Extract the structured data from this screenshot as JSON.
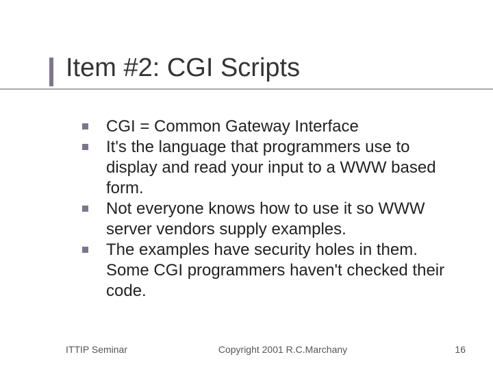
{
  "title": "Item #2:  CGI Scripts",
  "bullets": [
    "CGI = Common Gateway Interface",
    "It's the language that programmers use to display and read your input to a WWW based form.",
    "Not everyone knows how to use it so WWW server vendors supply examples.",
    "The examples have security holes in them. Some CGI programmers haven't checked their code."
  ],
  "footer": {
    "left": "ITTIP Seminar",
    "center": "Copyright 2001 R.C.Marchany",
    "right": "16"
  },
  "colors": {
    "accent": "#7e758d",
    "underline": "#a9a8b0"
  }
}
